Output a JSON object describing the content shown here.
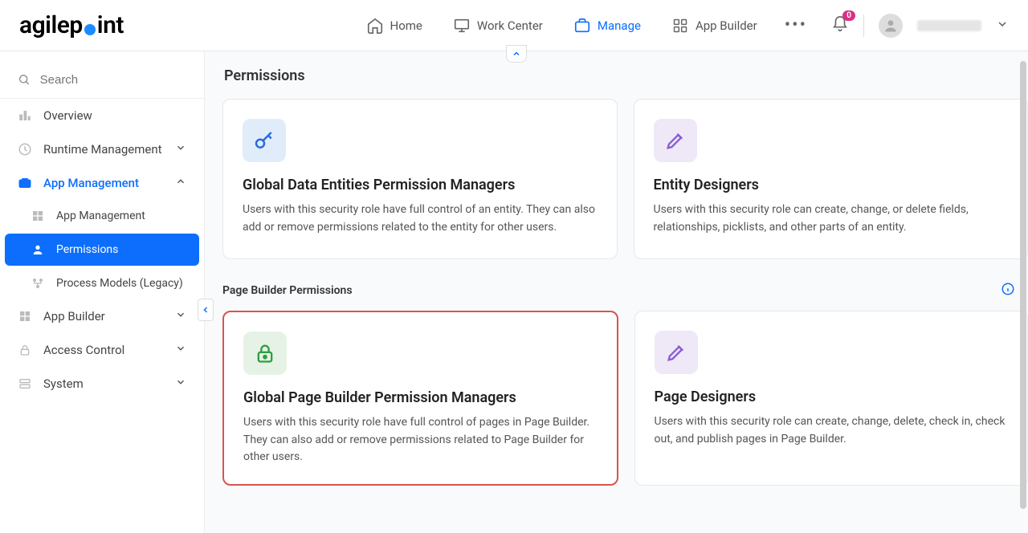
{
  "brand": {
    "text_before": "agilep",
    "text_after": "int"
  },
  "topnav": {
    "items": [
      {
        "label": "Home",
        "active": false
      },
      {
        "label": "Work Center",
        "active": false
      },
      {
        "label": "Manage",
        "active": true
      },
      {
        "label": "App Builder",
        "active": false
      }
    ],
    "notification_count": "0"
  },
  "search": {
    "placeholder": "Search"
  },
  "sidebar": {
    "items": [
      {
        "label": "Overview",
        "icon": "chart-icon",
        "type": "item"
      },
      {
        "label": "Runtime Management",
        "icon": "clock-icon",
        "type": "collapsible",
        "open": false
      },
      {
        "label": "App Management",
        "icon": "briefcase-icon",
        "type": "collapsible",
        "open": true,
        "children": [
          {
            "label": "App Management",
            "icon": "grid-icon",
            "active": false
          },
          {
            "label": "Permissions",
            "icon": "user-icon",
            "active": true
          },
          {
            "label": "Process Models (Legacy)",
            "icon": "flow-icon",
            "active": false
          }
        ]
      },
      {
        "label": "App Builder",
        "icon": "grid-icon",
        "type": "collapsible",
        "open": false
      },
      {
        "label": "Access Control",
        "icon": "lock-icon",
        "type": "collapsible",
        "open": false
      },
      {
        "label": "System",
        "icon": "server-icon",
        "type": "collapsible",
        "open": false
      }
    ]
  },
  "page": {
    "title": "Permissions",
    "section1_cards": [
      {
        "title": "Global Data Entities Permission Managers",
        "desc": "Users with this security role have full control of an entity. They can also add or remove permissions related to the entity for other users.",
        "icon": "key-icon",
        "icon_bg": "blue"
      },
      {
        "title": "Entity Designers",
        "desc": "Users with this security role can create, change, or delete fields, relationships, picklists, and other parts of an entity.",
        "icon": "design-icon",
        "icon_bg": "purple"
      }
    ],
    "section2": {
      "title": "Page Builder Permissions",
      "cards": [
        {
          "title": "Global Page Builder Permission Managers",
          "desc": "Users with this security role have full control of pages in Page Builder. They can also add or remove permissions related to Page Builder for other users.",
          "icon": "padlock-icon",
          "icon_bg": "green",
          "highlighted": true
        },
        {
          "title": "Page Designers",
          "desc": "Users with this security role can create, change, delete, check in, check out, and publish pages in Page Builder.",
          "icon": "design-icon",
          "icon_bg": "purple"
        }
      ]
    }
  }
}
